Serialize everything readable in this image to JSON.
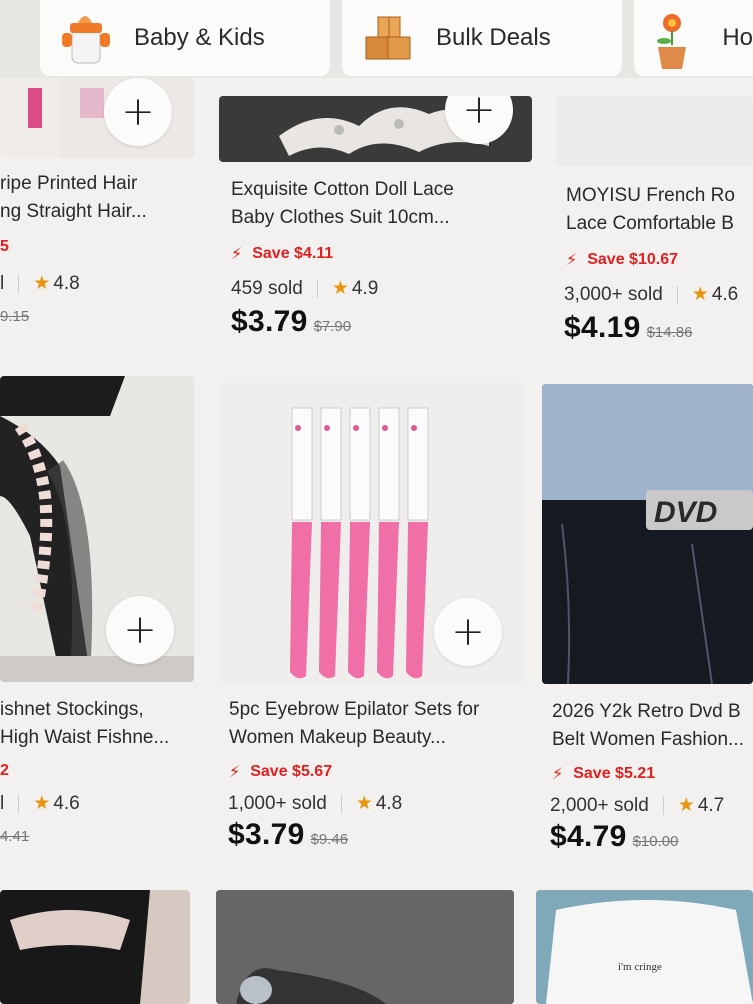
{
  "categories": [
    {
      "label": "Baby & Kids",
      "icon": "sippy-cup-icon"
    },
    {
      "label": "Bulk Deals",
      "icon": "boxes-icon"
    },
    {
      "label": "Ho",
      "icon": "flower-pot-icon"
    }
  ],
  "add_label": "+",
  "products": [
    {
      "title1": "ripe Printed Hair",
      "title2": "ng Straight Hair...",
      "save": "5",
      "sold": "l",
      "rating": "4.8",
      "price": "",
      "was": "9.15"
    },
    {
      "title1": "Exquisite Cotton Doll Lace",
      "title2": "Baby Clothes Suit 10cm...",
      "save": "Save $4.11",
      "sold": "459 sold",
      "rating": "4.9",
      "price": "$3.79",
      "was": "$7.90"
    },
    {
      "title1": "MOYISU French Ro",
      "title2": "Lace Comfortable B",
      "save": "Save $10.67",
      "sold": "3,000+ sold",
      "rating": "4.6",
      "price": "$4.19",
      "was": "$14.86"
    },
    {
      "title1": "ishnet Stockings,",
      "title2": "High Waist Fishne...",
      "save": "2",
      "sold": "l",
      "rating": "4.6",
      "price": "",
      "was": "4.41"
    },
    {
      "title1": "5pc Eyebrow Epilator Sets for",
      "title2": "Women Makeup Beauty...",
      "save": "Save $5.67",
      "sold": "1,000+ sold",
      "rating": "4.8",
      "price": "$3.79",
      "was": "$9.46"
    },
    {
      "title1": "2026 Y2k Retro Dvd B",
      "title2": "Belt Women Fashion...",
      "save": "Save $5.21",
      "sold": "2,000+ sold",
      "rating": "4.7",
      "price": "$4.79",
      "was": "$10.00"
    }
  ],
  "images": {
    "belt_text": "DVD",
    "shirt_text": "i'm cringe"
  },
  "colors": {
    "save_red": "#e02020",
    "star_orange": "#e8950e",
    "razor_pink": "#ef6fa6"
  }
}
